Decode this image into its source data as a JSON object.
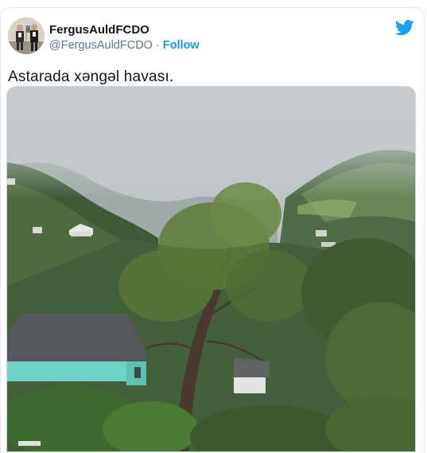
{
  "author": {
    "display_name": "FergusAuldFCDO",
    "handle": "@FergusAuldFCDO",
    "separator": "·",
    "follow_label": "Follow",
    "avatar_icon": "profile-photo"
  },
  "brand": {
    "icon": "twitter-bird-icon",
    "color": "#1da1f2"
  },
  "tweet": {
    "text": "Astarada xəngəl havası.",
    "media": {
      "type": "photo"
    }
  },
  "colors": {
    "link": "#1b95e0",
    "text": "#14171a",
    "muted": "#657786",
    "border": "#e1e8ed"
  }
}
